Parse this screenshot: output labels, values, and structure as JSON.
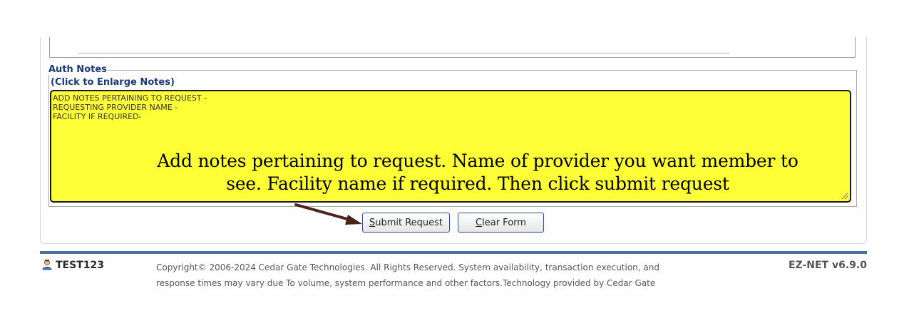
{
  "notes": {
    "legend": "Auth Notes",
    "enlarge_link": "(Click to Enlarge Notes)",
    "textarea_value": "ADD NOTES PERTAINING TO REQUEST -\nREQUESTING PROVIDER NAME -\nFACILITY IF REQUIRED-",
    "background_color": "#ffff38"
  },
  "annotation": {
    "line1": "Add notes pertaining to request. Name of provider you want member to",
    "line2": "see. Facility name if required. Then click submit request",
    "arrow_color": "#4a2418"
  },
  "buttons": {
    "submit": {
      "access_key": "S",
      "rest": "ubmit Request"
    },
    "clear": {
      "access_key": "C",
      "rest": "lear Form"
    }
  },
  "footer": {
    "user_icon": "user-icon",
    "username": "TEST123",
    "copyright_line1": "Copyright© 2006-2024 Cedar Gate Technologies. All Rights Reserved. System availability, transaction execution, and",
    "copyright_line2": "response times may vary due To volume, system performance and other factors.Technology provided by Cedar Gate",
    "version": "EZ-NET v6.9.0",
    "accent_color": "#4a6f96"
  }
}
